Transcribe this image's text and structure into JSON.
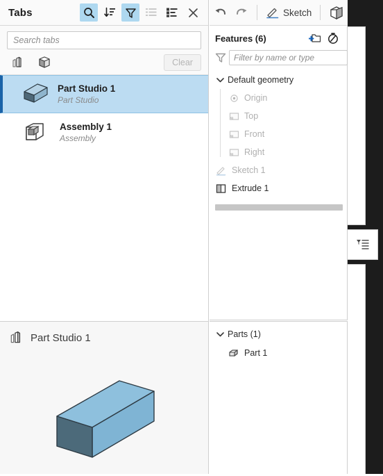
{
  "tabs_panel": {
    "title": "Tabs",
    "header_buttons": [
      {
        "name": "search-toggle",
        "icon": "search-icon",
        "active": true
      },
      {
        "name": "sort-toggle",
        "icon": "sort-descending-icon",
        "active": false
      },
      {
        "name": "filter-toggle",
        "icon": "funnel-icon",
        "active": true
      },
      {
        "name": "list-view-toggle",
        "icon": "list-view-icon",
        "active": false
      },
      {
        "name": "detail-view-toggle",
        "icon": "detail-list-icon",
        "active": false
      },
      {
        "name": "close-panel",
        "icon": "close-icon",
        "active": false
      }
    ],
    "search": {
      "value": "",
      "placeholder": "Search tabs"
    },
    "type_filters": [
      {
        "name": "part-studio-filter",
        "icon": "part-studio-icon"
      },
      {
        "name": "assembly-filter",
        "icon": "assembly-icon"
      }
    ],
    "clear_label": "Clear",
    "items": [
      {
        "name": "Part Studio 1",
        "type": "Part Studio",
        "icon": "part-box-icon",
        "selected": true
      },
      {
        "name": "Assembly 1",
        "type": "Assembly",
        "icon": "assembly-cube-icon",
        "selected": false
      }
    ]
  },
  "preview": {
    "title": "Part Studio 1",
    "icon": "part-studio-icon",
    "model": {
      "top_face_color": "#8ec0dd",
      "side_face_color": "#7fb4d4",
      "end_face_color": "#4c6a7a",
      "edge_color": "#2e3b44"
    }
  },
  "toolbar": {
    "undo_label": "",
    "redo_label": "",
    "sketch_label": "Sketch",
    "buttons": [
      {
        "name": "undo-button",
        "icon": "undo-arrow-icon"
      },
      {
        "name": "redo-button",
        "icon": "redo-arrow-icon"
      },
      {
        "name": "sketch-button",
        "icon": "pencil-icon"
      },
      {
        "name": "extrude-button",
        "icon": "extrude-icon"
      },
      {
        "name": "revolve-button",
        "icon": "revolve-icon"
      }
    ]
  },
  "features": {
    "title": "Features (6)",
    "header_buttons": [
      {
        "name": "new-folder-button",
        "icon": "new-folder-icon"
      },
      {
        "name": "rollback-button",
        "icon": "stopwatch-icon"
      }
    ],
    "filter": {
      "value": "",
      "placeholder": "Filter by name or type"
    },
    "tree": [
      {
        "label": "Default geometry",
        "icon": "none",
        "muted": false,
        "expanded": true,
        "children": [
          {
            "label": "Origin",
            "icon": "origin-icon",
            "muted": true
          },
          {
            "label": "Top",
            "icon": "plane-icon",
            "muted": true
          },
          {
            "label": "Front",
            "icon": "plane-icon",
            "muted": true
          },
          {
            "label": "Right",
            "icon": "plane-icon",
            "muted": true
          }
        ]
      },
      {
        "label": "Sketch 1",
        "icon": "pencil-icon",
        "muted": true,
        "children": []
      },
      {
        "label": "Extrude 1",
        "icon": "extrude-icon",
        "muted": false,
        "children": []
      }
    ]
  },
  "parts": {
    "title": "Parts (1)",
    "items": [
      {
        "label": "Part 1",
        "icon": "part-icon"
      }
    ]
  },
  "right_strip": {
    "tab_icon": "filter-list-icon"
  },
  "colors": {
    "accent_blue": "#1a63a8",
    "active_bg": "#aed8f0",
    "selected_row": "#bcdcf2",
    "panel_bg": "#fafafa",
    "border": "#cfcfcf"
  }
}
